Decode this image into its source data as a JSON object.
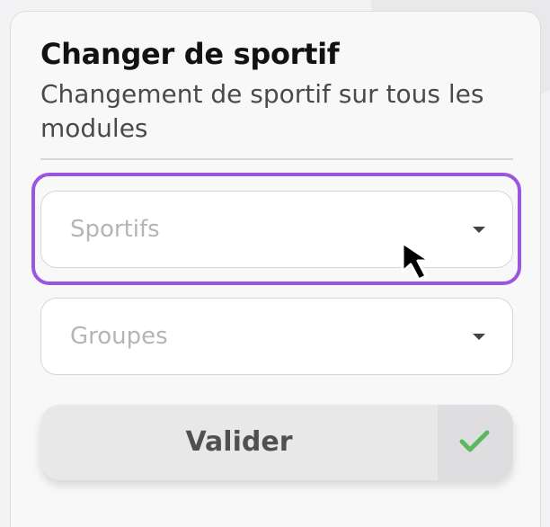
{
  "header": {
    "title": "Changer de sportif",
    "subtitle": "Changement de sportif sur tous les modules"
  },
  "fields": {
    "sportifs": {
      "placeholder": "Sportifs",
      "icon": "caret-down-icon"
    },
    "groupes": {
      "placeholder": "Groupes",
      "icon": "caret-down-icon"
    }
  },
  "actions": {
    "submit_label": "Valider",
    "submit_icon": "check-icon"
  },
  "colors": {
    "focus_ring": "#9b55e0",
    "check": "#5cb85c",
    "title": "#121212"
  },
  "state": {
    "focused_field": "sportifs",
    "cursor_icon": "mouse-pointer-icon"
  }
}
